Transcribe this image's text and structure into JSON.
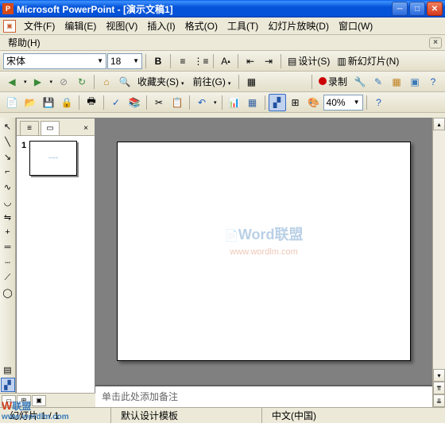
{
  "title": "Microsoft PowerPoint - [演示文稿1]",
  "menu": {
    "file": "文件(F)",
    "edit": "编辑(E)",
    "view": "视图(V)",
    "insert": "插入(I)",
    "format": "格式(O)",
    "tools": "工具(T)",
    "slideshow": "幻灯片放映(D)",
    "window": "窗口(W)",
    "help": "帮助(H)"
  },
  "format_toolbar": {
    "font": "宋体",
    "size": "18",
    "design_label": "设计(S)",
    "newslide_label": "新幻灯片(N)"
  },
  "web_toolbar": {
    "fav_label": "收藏夹(S)",
    "go_label": "前往(G)"
  },
  "rec_toolbar": {
    "record_label": "录制"
  },
  "std_toolbar": {
    "zoom": "40%"
  },
  "outline": {
    "slide1_num": "1"
  },
  "notes": {
    "placeholder": "单击此处添加备注"
  },
  "status": {
    "slide": "幻灯片 1 / 1",
    "template": "默认设计模板",
    "lang": "中文(中国)"
  },
  "watermark": {
    "line1": "Word联盟",
    "line2": "www.wordlm.com"
  },
  "cornerwm": {
    "a": "W",
    "b": "联盟",
    "c": "www.wordlm.com"
  }
}
